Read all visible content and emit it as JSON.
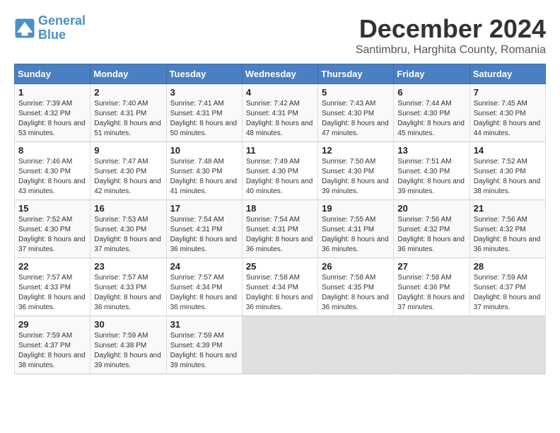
{
  "header": {
    "logo_line1": "General",
    "logo_line2": "Blue",
    "month_title": "December 2024",
    "subtitle": "Santimbru, Harghita County, Romania"
  },
  "columns": [
    "Sunday",
    "Monday",
    "Tuesday",
    "Wednesday",
    "Thursday",
    "Friday",
    "Saturday"
  ],
  "weeks": [
    {
      "class": "week-row-1",
      "days": [
        {
          "num": "1",
          "sunrise": "Sunrise: 7:39 AM",
          "sunset": "Sunset: 4:32 PM",
          "daylight": "Daylight: 8 hours and 53 minutes."
        },
        {
          "num": "2",
          "sunrise": "Sunrise: 7:40 AM",
          "sunset": "Sunset: 4:31 PM",
          "daylight": "Daylight: 8 hours and 51 minutes."
        },
        {
          "num": "3",
          "sunrise": "Sunrise: 7:41 AM",
          "sunset": "Sunset: 4:31 PM",
          "daylight": "Daylight: 8 hours and 50 minutes."
        },
        {
          "num": "4",
          "sunrise": "Sunrise: 7:42 AM",
          "sunset": "Sunset: 4:31 PM",
          "daylight": "Daylight: 8 hours and 48 minutes."
        },
        {
          "num": "5",
          "sunrise": "Sunrise: 7:43 AM",
          "sunset": "Sunset: 4:30 PM",
          "daylight": "Daylight: 8 hours and 47 minutes."
        },
        {
          "num": "6",
          "sunrise": "Sunrise: 7:44 AM",
          "sunset": "Sunset: 4:30 PM",
          "daylight": "Daylight: 8 hours and 45 minutes."
        },
        {
          "num": "7",
          "sunrise": "Sunrise: 7:45 AM",
          "sunset": "Sunset: 4:30 PM",
          "daylight": "Daylight: 8 hours and 44 minutes."
        }
      ]
    },
    {
      "class": "week-row-2",
      "days": [
        {
          "num": "8",
          "sunrise": "Sunrise: 7:46 AM",
          "sunset": "Sunset: 4:30 PM",
          "daylight": "Daylight: 8 hours and 43 minutes."
        },
        {
          "num": "9",
          "sunrise": "Sunrise: 7:47 AM",
          "sunset": "Sunset: 4:30 PM",
          "daylight": "Daylight: 8 hours and 42 minutes."
        },
        {
          "num": "10",
          "sunrise": "Sunrise: 7:48 AM",
          "sunset": "Sunset: 4:30 PM",
          "daylight": "Daylight: 8 hours and 41 minutes."
        },
        {
          "num": "11",
          "sunrise": "Sunrise: 7:49 AM",
          "sunset": "Sunset: 4:30 PM",
          "daylight": "Daylight: 8 hours and 40 minutes."
        },
        {
          "num": "12",
          "sunrise": "Sunrise: 7:50 AM",
          "sunset": "Sunset: 4:30 PM",
          "daylight": "Daylight: 8 hours and 39 minutes."
        },
        {
          "num": "13",
          "sunrise": "Sunrise: 7:51 AM",
          "sunset": "Sunset: 4:30 PM",
          "daylight": "Daylight: 8 hours and 39 minutes."
        },
        {
          "num": "14",
          "sunrise": "Sunrise: 7:52 AM",
          "sunset": "Sunset: 4:30 PM",
          "daylight": "Daylight: 8 hours and 38 minutes."
        }
      ]
    },
    {
      "class": "week-row-3",
      "days": [
        {
          "num": "15",
          "sunrise": "Sunrise: 7:52 AM",
          "sunset": "Sunset: 4:30 PM",
          "daylight": "Daylight: 8 hours and 37 minutes."
        },
        {
          "num": "16",
          "sunrise": "Sunrise: 7:53 AM",
          "sunset": "Sunset: 4:30 PM",
          "daylight": "Daylight: 8 hours and 37 minutes."
        },
        {
          "num": "17",
          "sunrise": "Sunrise: 7:54 AM",
          "sunset": "Sunset: 4:31 PM",
          "daylight": "Daylight: 8 hours and 36 minutes."
        },
        {
          "num": "18",
          "sunrise": "Sunrise: 7:54 AM",
          "sunset": "Sunset: 4:31 PM",
          "daylight": "Daylight: 8 hours and 36 minutes."
        },
        {
          "num": "19",
          "sunrise": "Sunrise: 7:55 AM",
          "sunset": "Sunset: 4:31 PM",
          "daylight": "Daylight: 8 hours and 36 minutes."
        },
        {
          "num": "20",
          "sunrise": "Sunrise: 7:56 AM",
          "sunset": "Sunset: 4:32 PM",
          "daylight": "Daylight: 8 hours and 36 minutes."
        },
        {
          "num": "21",
          "sunrise": "Sunrise: 7:56 AM",
          "sunset": "Sunset: 4:32 PM",
          "daylight": "Daylight: 8 hours and 36 minutes."
        }
      ]
    },
    {
      "class": "week-row-4",
      "days": [
        {
          "num": "22",
          "sunrise": "Sunrise: 7:57 AM",
          "sunset": "Sunset: 4:33 PM",
          "daylight": "Daylight: 8 hours and 36 minutes."
        },
        {
          "num": "23",
          "sunrise": "Sunrise: 7:57 AM",
          "sunset": "Sunset: 4:33 PM",
          "daylight": "Daylight: 8 hours and 36 minutes."
        },
        {
          "num": "24",
          "sunrise": "Sunrise: 7:57 AM",
          "sunset": "Sunset: 4:34 PM",
          "daylight": "Daylight: 8 hours and 36 minutes."
        },
        {
          "num": "25",
          "sunrise": "Sunrise: 7:58 AM",
          "sunset": "Sunset: 4:34 PM",
          "daylight": "Daylight: 8 hours and 36 minutes."
        },
        {
          "num": "26",
          "sunrise": "Sunrise: 7:58 AM",
          "sunset": "Sunset: 4:35 PM",
          "daylight": "Daylight: 8 hours and 36 minutes."
        },
        {
          "num": "27",
          "sunrise": "Sunrise: 7:58 AM",
          "sunset": "Sunset: 4:36 PM",
          "daylight": "Daylight: 8 hours and 37 minutes."
        },
        {
          "num": "28",
          "sunrise": "Sunrise: 7:59 AM",
          "sunset": "Sunset: 4:37 PM",
          "daylight": "Daylight: 8 hours and 37 minutes."
        }
      ]
    },
    {
      "class": "week-row-5",
      "days": [
        {
          "num": "29",
          "sunrise": "Sunrise: 7:59 AM",
          "sunset": "Sunset: 4:37 PM",
          "daylight": "Daylight: 8 hours and 38 minutes."
        },
        {
          "num": "30",
          "sunrise": "Sunrise: 7:59 AM",
          "sunset": "Sunset: 4:38 PM",
          "daylight": "Daylight: 8 hours and 39 minutes."
        },
        {
          "num": "31",
          "sunrise": "Sunrise: 7:59 AM",
          "sunset": "Sunset: 4:39 PM",
          "daylight": "Daylight: 8 hours and 39 minutes."
        },
        null,
        null,
        null,
        null
      ]
    }
  ]
}
